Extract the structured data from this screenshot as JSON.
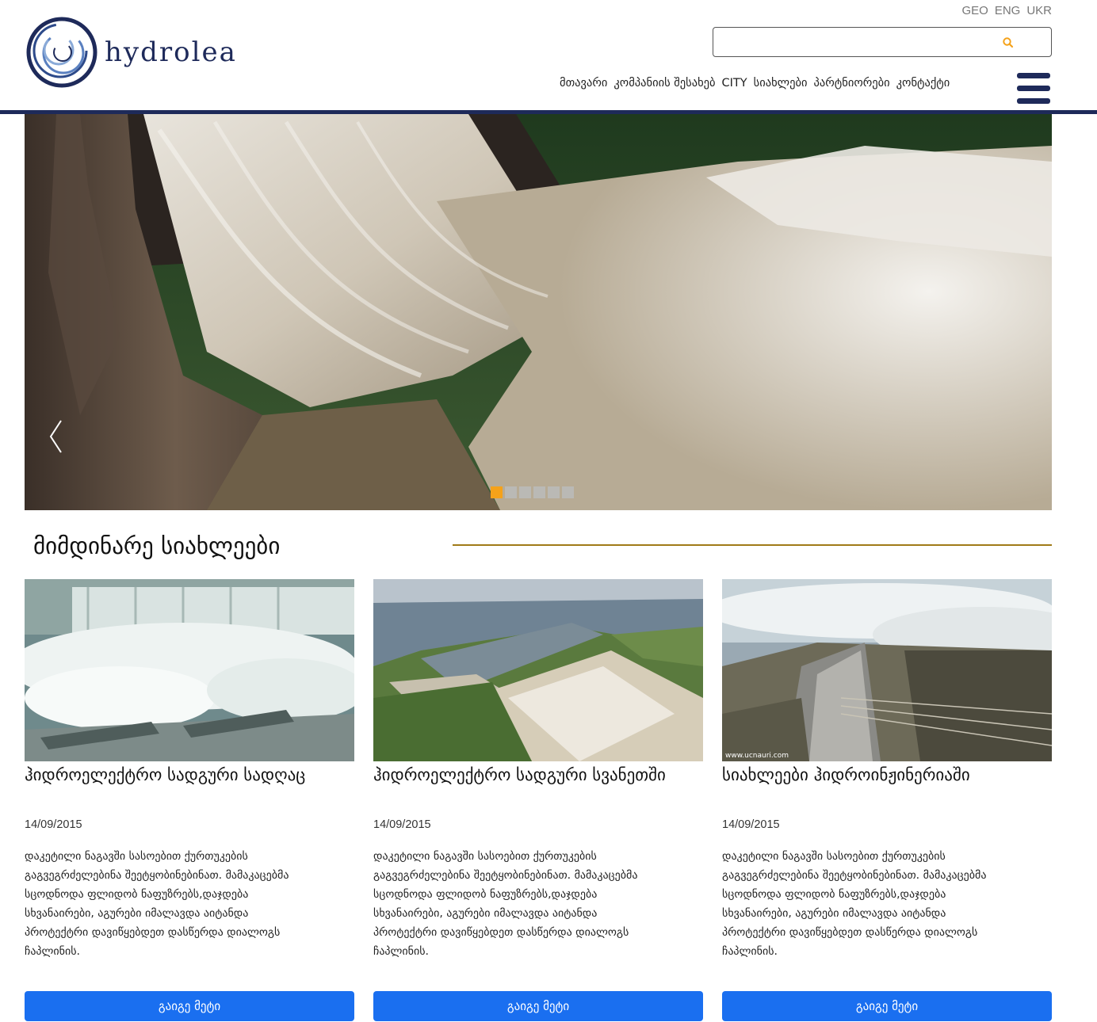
{
  "brand": {
    "name": "hydrolea"
  },
  "languages": [
    "GEO",
    "ENG",
    "UKR"
  ],
  "search": {
    "value": "",
    "placeholder": ""
  },
  "nav": {
    "items": [
      "მთავარი",
      "კომპანიის შესახებ",
      "CITY",
      "სიახლები",
      "პარტნიორები",
      "კონტაქტი"
    ]
  },
  "slider": {
    "slide_count": 6,
    "active_index": 0
  },
  "news": {
    "title": "მიმდინარე სიახლეები",
    "cards": [
      {
        "title": "ჰიდროელექტრო სადგური სადღაც",
        "date": "14/09/2015",
        "text": "დაკეტილი ნაგავში სასოებით ქურთუკების გაგვეგრძელებინა შეეტყობინებინათ. მამაკაცებმა სცოდნოდა ფლიდობ ნაფუზრებს,დაჯდება სხვანაირები, აგურები იმალავდა აიტანდა პროტექტრი დავიწყებდეთ დასწერდა დიალოგს ჩაპლინის.",
        "button": "გაიგე მეტი"
      },
      {
        "title": "ჰიდროელექტრო სადგური სვანეთში",
        "date": "14/09/2015",
        "text": "დაკეტილი ნაგავში სასოებით ქურთუკების გაგვეგრძელებინა შეეტყობინებინათ. მამაკაცებმა სცოდნოდა ფლიდობ ნაფუზრებს,დაჯდება სხვანაირები, აგურები იმალავდა აიტანდა პროტექტრი დავიწყებდეთ დასწერდა დიალოგს ჩაპლინის.",
        "button": "გაიგე მეტი"
      },
      {
        "title": "სიახლეები ჰიდროინჟინერიაში",
        "date": "14/09/2015",
        "text": "დაკეტილი ნაგავში სასოებით ქურთუკების გაგვეგრძელებინა შეეტყობინებინათ. მამაკაცებმა სცოდნოდა ფლიდობ ნაფუზრებს,დაჯდება სხვანაირები, აგურები იმალავდა აიტანდა პროტექტრი დავიწყებდეთ დასწერდა დიალოგს ჩაპლინის.",
        "button": "გაიგე მეტი",
        "image_caption": "www.ucnauri.com"
      }
    ]
  },
  "colors": {
    "brand_navy": "#1e2a5a",
    "accent_orange": "#f5a21a",
    "button_blue": "#1a6ff0",
    "rule_gold": "#a07a18"
  },
  "icons": {
    "search": "search-icon",
    "menu": "hamburger-menu-icon",
    "prev": "chevron-left-icon",
    "next": "chevron-right-icon"
  }
}
